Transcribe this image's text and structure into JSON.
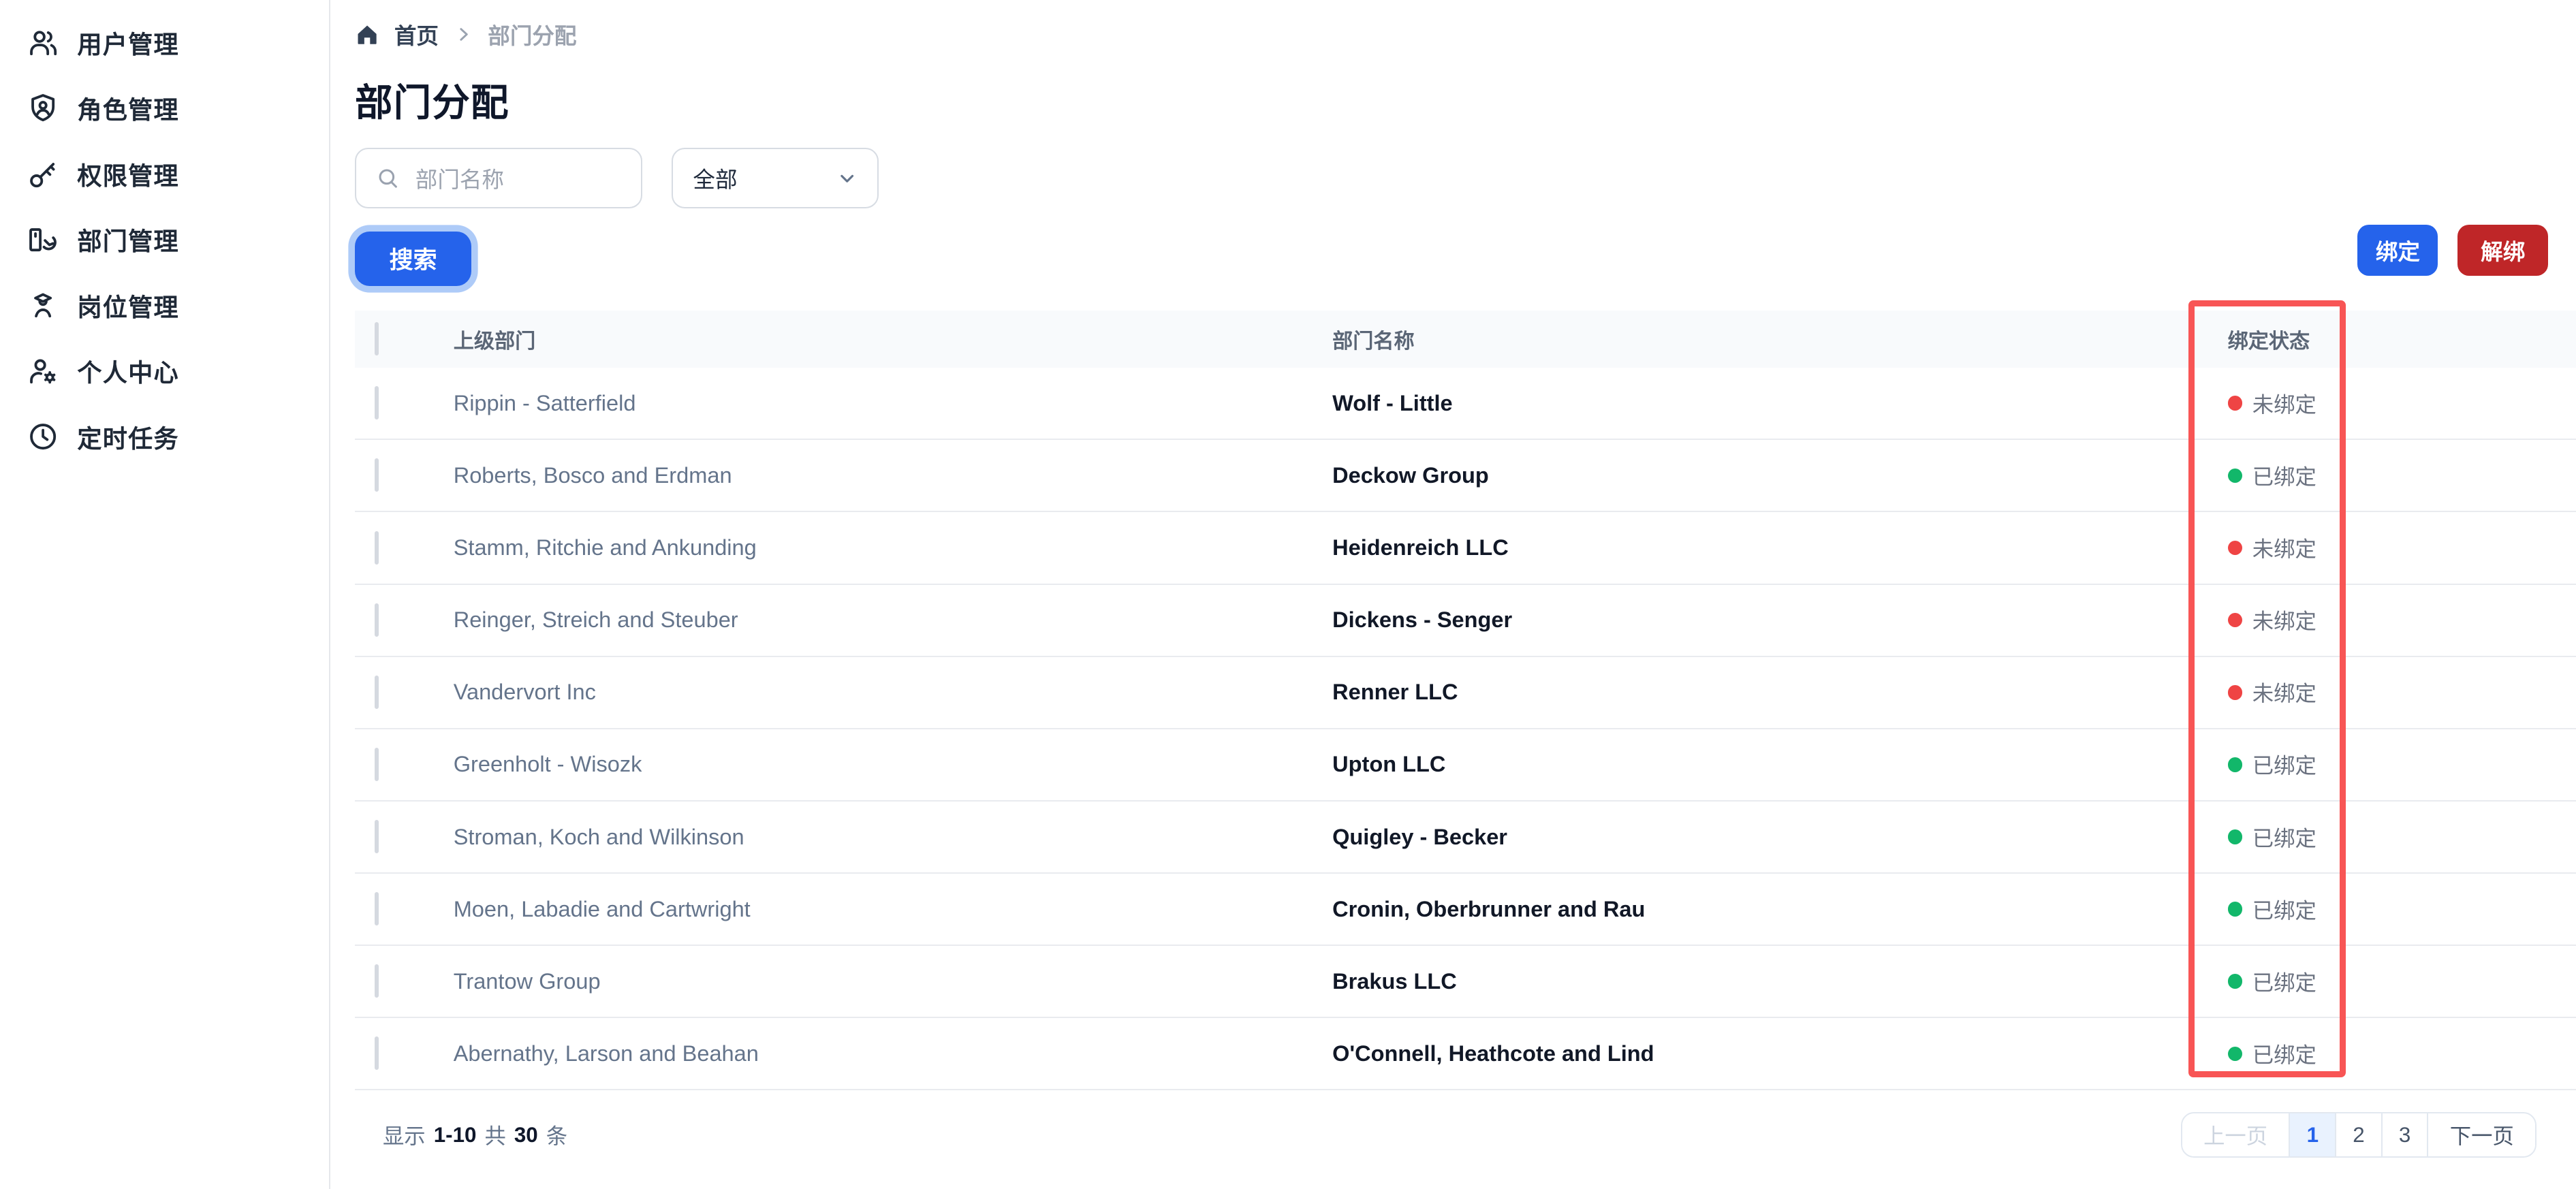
{
  "sidebar": {
    "items": [
      {
        "label": "用户管理",
        "icon": "users-icon"
      },
      {
        "label": "角色管理",
        "icon": "shield-user-icon"
      },
      {
        "label": "权限管理",
        "icon": "key-icon"
      },
      {
        "label": "部门管理",
        "icon": "department-icon"
      },
      {
        "label": "岗位管理",
        "icon": "position-badge-icon"
      },
      {
        "label": "个人中心",
        "icon": "user-gear-icon"
      },
      {
        "label": "定时任务",
        "icon": "clock-icon"
      }
    ]
  },
  "breadcrumb": {
    "home": "首页",
    "current": "部门分配"
  },
  "page": {
    "title": "部门分配"
  },
  "filters": {
    "search_placeholder": "部门名称",
    "select_value": "全部"
  },
  "actions": {
    "search": "搜索",
    "bind": "绑定",
    "unbind": "解绑"
  },
  "table": {
    "columns": {
      "parent": "上级部门",
      "name": "部门名称",
      "status": "绑定状态"
    },
    "rows": [
      {
        "parent": "Rippin - Satterfield",
        "name": "Wolf - Little",
        "bound": false,
        "status_label": "未绑定"
      },
      {
        "parent": "Roberts, Bosco and Erdman",
        "name": "Deckow Group",
        "bound": true,
        "status_label": "已绑定"
      },
      {
        "parent": "Stamm, Ritchie and Ankunding",
        "name": "Heidenreich LLC",
        "bound": false,
        "status_label": "未绑定"
      },
      {
        "parent": "Reinger, Streich and Steuber",
        "name": "Dickens - Senger",
        "bound": false,
        "status_label": "未绑定"
      },
      {
        "parent": "Vandervort Inc",
        "name": "Renner LLC",
        "bound": false,
        "status_label": "未绑定"
      },
      {
        "parent": "Greenholt - Wisozk",
        "name": "Upton LLC",
        "bound": true,
        "status_label": "已绑定"
      },
      {
        "parent": "Stroman, Koch and Wilkinson",
        "name": "Quigley - Becker",
        "bound": true,
        "status_label": "已绑定"
      },
      {
        "parent": "Moen, Labadie and Cartwright",
        "name": "Cronin, Oberbrunner and Rau",
        "bound": true,
        "status_label": "已绑定"
      },
      {
        "parent": "Trantow Group",
        "name": "Brakus LLC",
        "bound": true,
        "status_label": "已绑定"
      },
      {
        "parent": "Abernathy, Larson and Beahan",
        "name": "O'Connell, Heathcote and Lind",
        "bound": true,
        "status_label": "已绑定"
      }
    ]
  },
  "pagination": {
    "summary_prefix": "显示",
    "summary_range": "1-10",
    "summary_middle": "共",
    "summary_total": "30",
    "summary_suffix": "条",
    "prev": "上一页",
    "pages": [
      "1",
      "2",
      "3"
    ],
    "active_page": "1",
    "next": "下一页"
  },
  "colors": {
    "accent_blue": "#2563eb",
    "danger_red": "#bf2628",
    "dot_red": "#ef4444",
    "dot_green": "#12b76a",
    "highlight_red": "#f85555"
  }
}
